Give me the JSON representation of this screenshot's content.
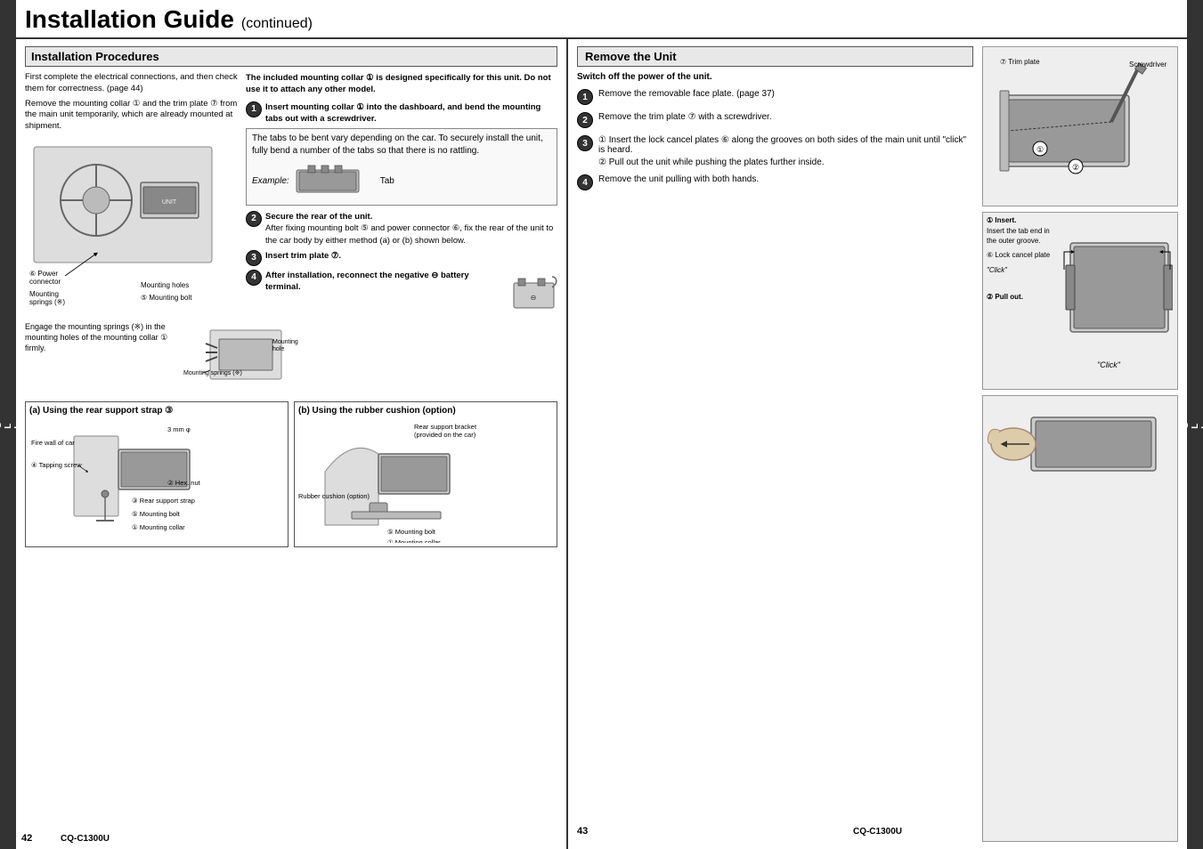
{
  "header": {
    "title": "Installation Guide",
    "subtitle": "(continued)"
  },
  "left_tab": {
    "text": "ENGLISH"
  },
  "right_tab": {
    "text": "ENGLISH"
  },
  "left_page": {
    "page_num": "42",
    "brand": "CQ-C1300U",
    "section_title": "Installation Procedures",
    "intro_text": "First complete the electrical connections, and then check them for correctness. (page 44)",
    "remove_text": "Remove the mounting collar ① and the trim plate ⑦ from the main unit temporarily, which are already mounted at shipment.",
    "power_connector": "⑥ Power connector",
    "mounting_springs": "Mounting springs (※)",
    "mounting_holes": "Mounting holes",
    "mounting_bolt": "⑤ Mounting bolt",
    "collar_note": "The included mounting collar ① is designed specifically for this unit. Do not use it to attach any other model.",
    "step1_title": "Insert mounting collar ① into the dashboard, and bend the mounting tabs out with a screwdriver.",
    "tabs_note": "The tabs to be bent vary depending on the car. To securely install the unit, fully bend a number of the tabs so that there is no rattling.",
    "example_label": "Example:",
    "tab_label": "Tab",
    "step2_title": "Secure the rear of the unit.",
    "step2_text": "After fixing mounting bolt ⑤ and power connector ⑥, fix the rear of the unit to the car body by either method (a) or (b) shown below.",
    "step3_title": "Insert trim plate ⑦.",
    "step4_title": "After installation, reconnect the negative ⊖ battery terminal.",
    "engage_text": "Engage the mounting springs (※) in the mounting holes of the mounting collar ① firmly.",
    "mounting_hole": "Mounting hole",
    "mounting_springs_label": "Mounting springs (※)",
    "section_a": {
      "title": "(a) Using the rear support strap ③",
      "fire_wall": "Fire wall of car",
      "tapping_screw": "④ Tapping screw",
      "size": "3 mm φ",
      "hex_nut": "② Hex. nut",
      "rear_support_strap": "③ Rear support strap",
      "mounting_bolt": "⑤ Mounting bolt",
      "mounting_collar": "① Mounting collar"
    },
    "section_b": {
      "title": "(b) Using the rubber cushion (option)",
      "rubber_cushion": "Rubber cushion (option)",
      "rear_support": "Rear support bracket (provided on the car)",
      "mounting_bolt": "⑤ Mounting bolt",
      "mounting_collar": "① Mounting collar"
    }
  },
  "right_page": {
    "page_num": "43",
    "brand": "CQ-C1300U",
    "section_title": "Remove the Unit",
    "switch_text": "Switch off the power of the unit.",
    "step1_text": "Remove the removable face plate. (page 37)",
    "step2_text": "Remove the trim plate ⑦ with a screwdriver.",
    "step3a_text": "① Insert the lock cancel plates ⑥ along the grooves on both sides of the main unit until \"click\" is heard.",
    "step3b_text": "② Pull out the unit while pushing the plates further inside.",
    "step4_text": "Remove the unit pulling with both hands.",
    "diagram1": {
      "trim_plate": "⑦ Trim plate",
      "screwdriver": "Screwdriver",
      "step1_num": "①",
      "step2_num": "②"
    },
    "diagram2": {
      "insert_text": "① Insert.",
      "insert_tab": "Insert the tab end in the outer groove.",
      "lock_cancel": "⑥ Lock cancel plate",
      "click_text": "\"Click\"",
      "pull_text": "② Pull out."
    },
    "diagram3": {
      "description": "Pulling unit with both hands"
    }
  }
}
